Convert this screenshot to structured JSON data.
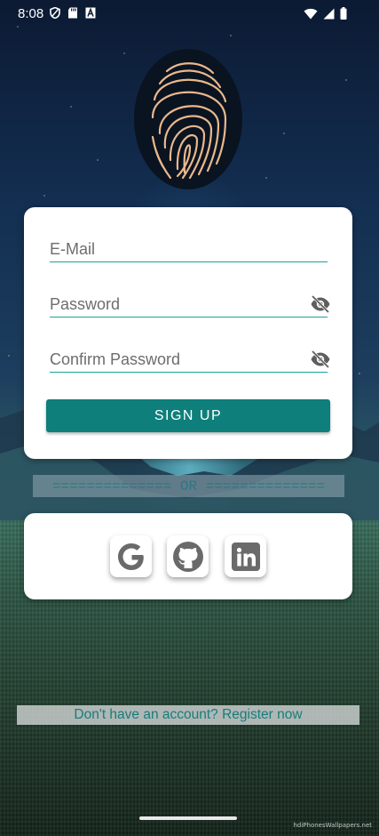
{
  "status_bar": {
    "time": "8:08",
    "left_icons": [
      "vpn-shield-icon",
      "sd-card-icon",
      "a-notification-icon"
    ],
    "right_icons": [
      "wifi-icon",
      "signal-icon",
      "battery-icon"
    ]
  },
  "form": {
    "email_placeholder": "E-Mail",
    "password_placeholder": "Password",
    "confirm_password_placeholder": "Confirm Password",
    "signup_label": "SIGN UP"
  },
  "divider_text": "============== OR ==============",
  "social": [
    "google-icon",
    "github-icon",
    "linkedin-icon"
  ],
  "register_text": "Don't have an account? Register now",
  "credit_text": "hdiPhonesWallpapers.net",
  "colors": {
    "accent": "#0e7f7a",
    "underline": "#1aa39a",
    "link": "#167d7a"
  }
}
